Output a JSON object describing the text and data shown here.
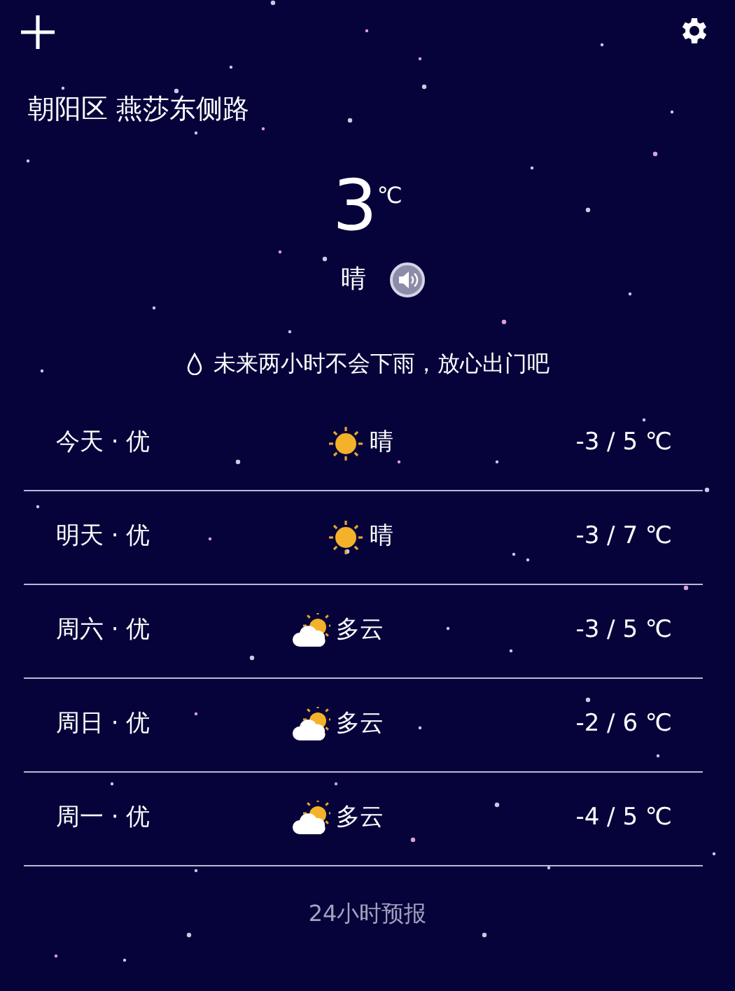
{
  "location": "朝阳区 燕莎东侧路",
  "current": {
    "temperature": "3",
    "unit": "℃",
    "condition": "晴"
  },
  "rain_notice": "未来两小时不会下雨，放心出门吧",
  "forecast": [
    {
      "day": "今天 · 优",
      "kind": "sunny",
      "condition": "晴",
      "range": "-3 / 5 ℃"
    },
    {
      "day": "明天 · 优",
      "kind": "sunny",
      "condition": "晴",
      "range": "-3 / 7 ℃"
    },
    {
      "day": "周六 · 优",
      "kind": "partly-cloudy",
      "condition": "多云",
      "range": "-3 / 5 ℃"
    },
    {
      "day": "周日 · 优",
      "kind": "partly-cloudy",
      "condition": "多云",
      "range": "-2 / 6 ℃"
    },
    {
      "day": "周一 · 优",
      "kind": "partly-cloudy",
      "condition": "多云",
      "range": "-4 / 5 ℃"
    }
  ],
  "hourly_link": "24小时预报"
}
